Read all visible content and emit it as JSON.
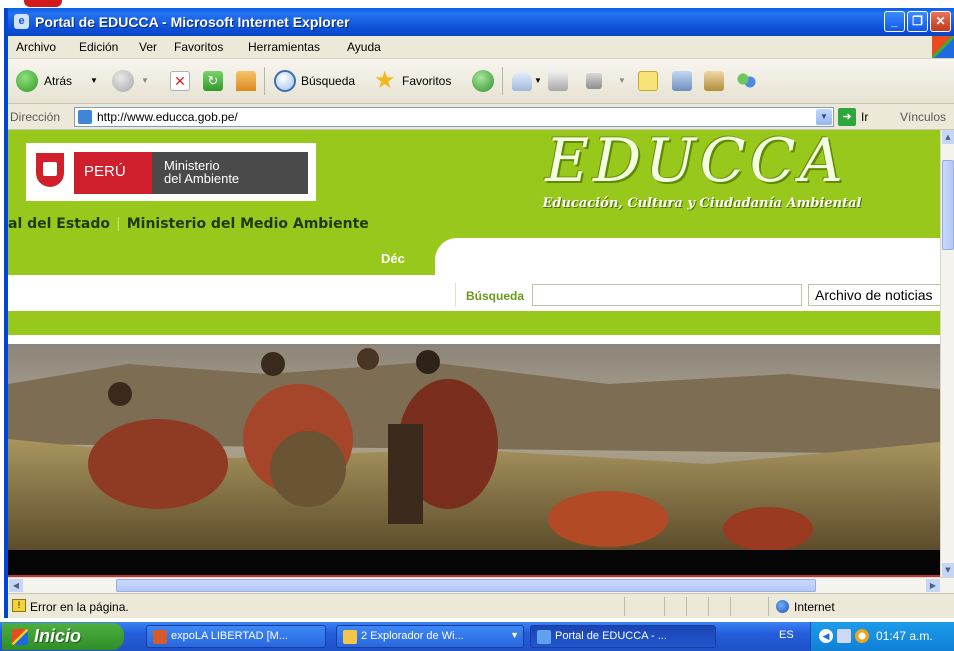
{
  "window": {
    "title": "Portal de EDUCCA - Microsoft Internet Explorer",
    "controls": [
      "_",
      "❐",
      "✕"
    ]
  },
  "menu": [
    "Archivo",
    "Edición",
    "Ver",
    "Favoritos",
    "Herramientas",
    "Ayuda"
  ],
  "toolbar": {
    "back_label": "Atrás",
    "search_label": "Búsqueda",
    "favorites_label": "Favoritos"
  },
  "address": {
    "label": "Dirección",
    "url": "http://www.educca.gob.pe/",
    "go_label": "Ir",
    "links_label": "Vínculos"
  },
  "page": {
    "logo": {
      "peru": "PERÚ",
      "ministry_line1": "Ministerio",
      "ministry_line2": "del Ambiente"
    },
    "brand": "EDUCCA",
    "tagline": "Educación, Cultura y Ciudadanía Ambiental",
    "breadcrumbs": [
      "al del Estado",
      "Ministerio del Medio Ambiente"
    ],
    "tab_fragment": "Déc",
    "search": {
      "label": "Búsqueda",
      "value": "",
      "archive_label": "Archivo de noticias"
    }
  },
  "status": {
    "message": "Error en la página.",
    "zone": "Internet"
  },
  "taskbar": {
    "start": "Inicio",
    "tasks": [
      {
        "label": "expoLA LIBERTAD [M..."
      },
      {
        "label": "2 Explorador de Wi..."
      },
      {
        "label": "Portal de EDUCCA - ..."
      }
    ],
    "lang": "ES",
    "clock": "01:47 a.m."
  },
  "colors": {
    "xp_blue": "#0a5fe8",
    "educca_green": "#99c81c",
    "peru_red": "#cf1f2d",
    "start_green": "#2f8d26"
  },
  "icons": [
    "ie-icon",
    "back-icon",
    "forward-icon",
    "stop-icon",
    "refresh-icon",
    "home-icon",
    "search-icon",
    "favorites-icon",
    "history-icon",
    "mail-icon",
    "print-icon",
    "edit-icon",
    "discuss-icon",
    "messenger-icon",
    "go-icon",
    "warning-icon",
    "globe-icon",
    "windows-flag-icon"
  ]
}
